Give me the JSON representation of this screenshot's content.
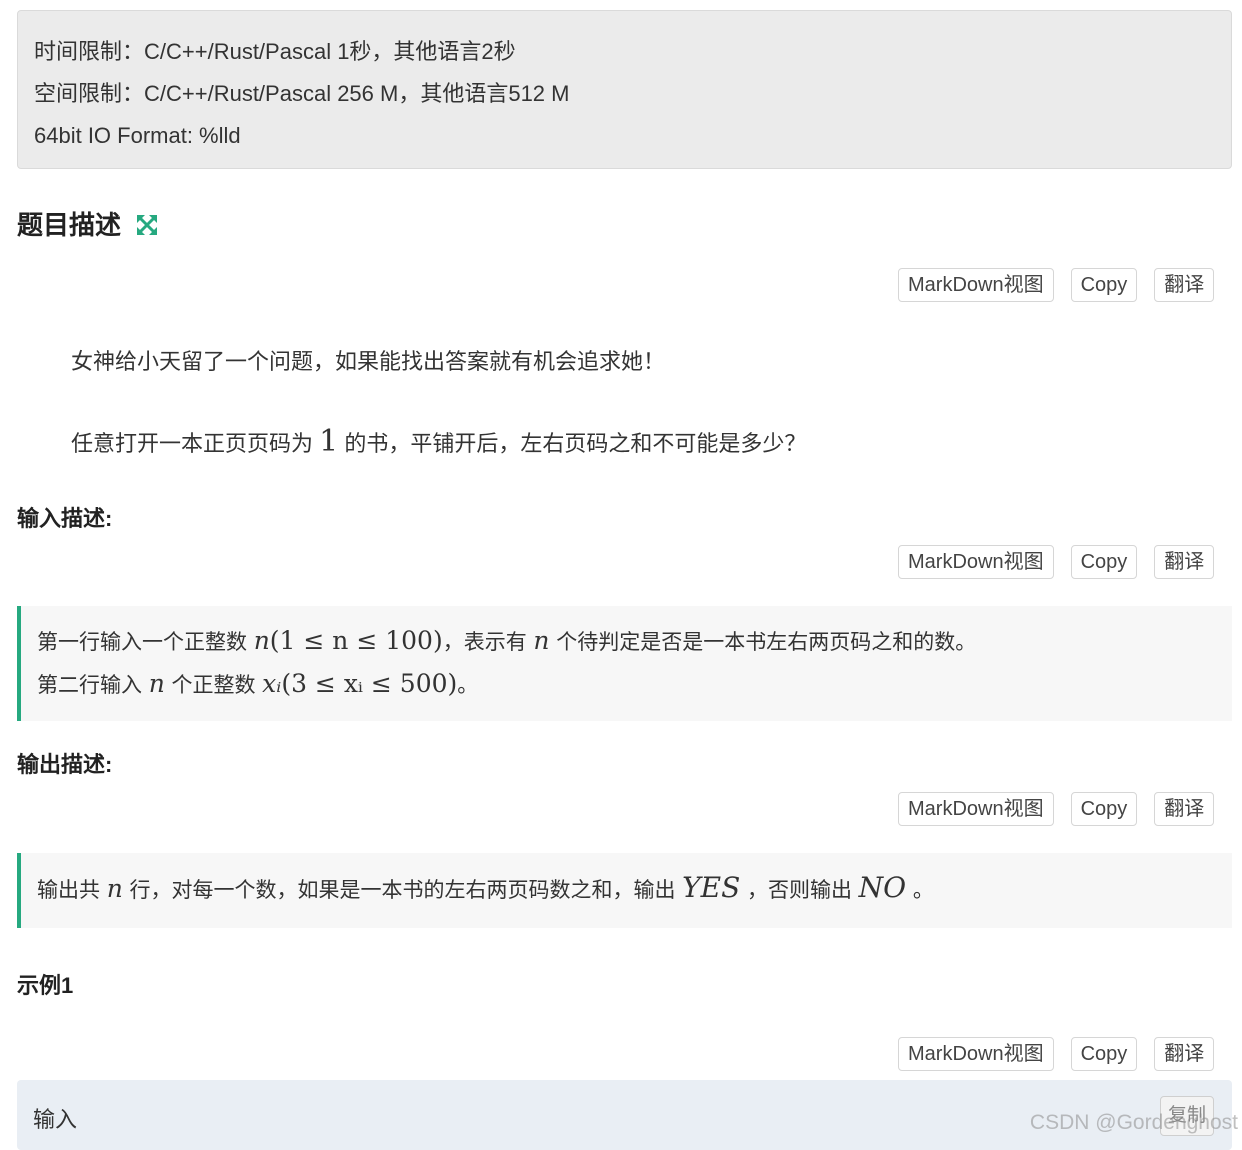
{
  "limits": {
    "time": "时间限制：C/C++/Rust/Pascal 1秒，其他语言2秒",
    "space": "空间限制：C/C++/Rust/Pascal 256 M，其他语言512 M",
    "io_format": "64bit IO Format: %lld"
  },
  "toolbar": {
    "markdown": "MarkDown视图",
    "copy": "Copy",
    "translate": "翻译"
  },
  "description": {
    "title": "题目描述",
    "p1": "女神给小天留了一个问题，如果能找出答案就有机会追求她！",
    "p2_before": "任意打开一本正页页码为",
    "p2_math": "1",
    "p2_after": "的书，平铺开后，左右页码之和不可能是多少？"
  },
  "input_desc": {
    "title": "输入描述:",
    "line1_a": "第一行输入一个正整数",
    "line1_var": "n",
    "line1_range": "(1 ≤ n ≤ 100)",
    "line1_b": "，表示有",
    "line1_var2": "n",
    "line1_c": "个待判定是否是一本书左右两页码之和的数。",
    "line2_a": "第二行输入",
    "line2_var": "n",
    "line2_b": "个正整数",
    "line2_var2": "xᵢ",
    "line2_range": "(3 ≤ xᵢ ≤ 500)",
    "line2_c": "。"
  },
  "output_desc": {
    "title": "输出描述:",
    "a": "输出共",
    "var": "n",
    "b": "行，对每一个数，如果是一本书的左右两页码数之和，输出",
    "yes": "YES",
    "c": "，否则输出",
    "no": "NO",
    "d": "。"
  },
  "example": {
    "title": "示例1",
    "input_label": "输入",
    "copy_label": "复制"
  },
  "watermark": "CSDN @Gordenghost",
  "colors": {
    "accent": "#26a980",
    "limits_bg": "#ebebeb",
    "quote_bg": "#f7f7f7",
    "sample_bg": "#e9eef4"
  }
}
